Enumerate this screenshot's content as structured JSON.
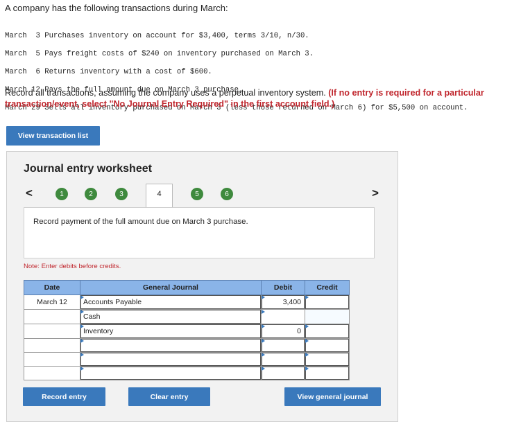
{
  "intro": "A company has the following transactions during March:",
  "transactions": [
    "March  3 Purchases inventory on account for $3,400, terms 3/10, n/30.",
    "March  5 Pays freight costs of $240 on inventory purchased on March 3.",
    "March  6 Returns inventory with a cost of $600.",
    "March 12 Pays the full amount due on March 3 purchase.",
    "March 29 Sells all inventory purchased on March 3 (less those returned on March 6) for $5,500 on account."
  ],
  "instructions": {
    "main": "Record all transactions, assuming the company uses a perpetual inventory system.",
    "red": "(If no entry is required for a particular transaction/event, select \"No Journal Entry Required\" in the first account field.)"
  },
  "buttons": {
    "view_transaction_list": "View transaction list",
    "record_entry": "Record entry",
    "clear_entry": "Clear entry",
    "view_general_journal": "View general journal"
  },
  "worksheet": {
    "title": "Journal entry worksheet",
    "prev_arrow": "<",
    "next_arrow": ">",
    "steps": [
      "1",
      "2",
      "3",
      "4",
      "5",
      "6"
    ],
    "active_step": "4",
    "description": "Record payment of the full amount due on March 3 purchase.",
    "note": "Note: Enter debits before credits."
  },
  "journal": {
    "headers": {
      "date": "Date",
      "account": "General Journal",
      "debit": "Debit",
      "credit": "Credit"
    },
    "rows": [
      {
        "date": "March 12",
        "account": "Accounts Payable",
        "debit": "3,400",
        "credit": ""
      },
      {
        "date": "",
        "account": "Cash",
        "debit": "",
        "credit": ""
      },
      {
        "date": "",
        "account": "Inventory",
        "debit": "0",
        "credit": ""
      },
      {
        "date": "",
        "account": "",
        "debit": "",
        "credit": ""
      },
      {
        "date": "",
        "account": "",
        "debit": "",
        "credit": ""
      },
      {
        "date": "",
        "account": "",
        "debit": "",
        "credit": ""
      }
    ]
  },
  "colors": {
    "accent": "#3a79bc",
    "step_green": "#3f8a3e",
    "warning_red": "#c0262d",
    "header_blue": "#8ab4e8"
  }
}
